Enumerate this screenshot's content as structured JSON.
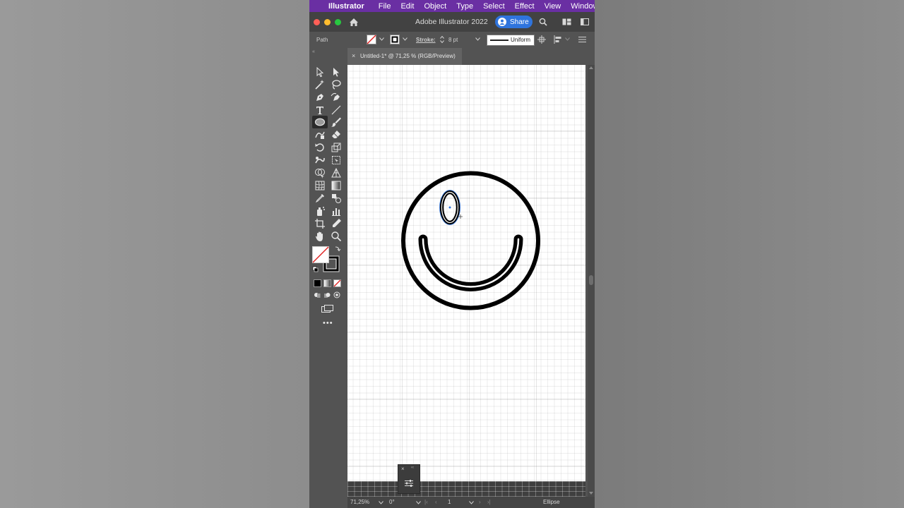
{
  "menubar": {
    "app_name": "Illustrator",
    "items": [
      "File",
      "Edit",
      "Object",
      "Type",
      "Select",
      "Effect",
      "View",
      "Window"
    ]
  },
  "titlebar": {
    "title": "Adobe Illustrator 2022",
    "share_label": "Share"
  },
  "controlbar": {
    "selection_label": "Path",
    "stroke_label": "Stroke:",
    "stroke_weight": "8 pt",
    "profile_label": "Uniform"
  },
  "document": {
    "tab_title": "Untitled-1* @ 71,25 % (RGB/Preview)"
  },
  "statusbar": {
    "zoom": "71,25%",
    "rotation": "0°",
    "artboard_number": "1",
    "current_tool": "Ellipse"
  },
  "colors": {
    "menubar": "#6a2fa3",
    "share_button": "#2f74dd",
    "ui_panel": "#535353"
  },
  "icons": {
    "tools": [
      "selection-tool-icon",
      "direct-selection-tool-icon",
      "magic-wand-tool-icon",
      "lasso-tool-icon",
      "pen-tool-icon",
      "curvature-tool-icon",
      "type-tool-icon",
      "line-segment-tool-icon",
      "ellipse-tool-icon",
      "paintbrush-tool-icon",
      "shaper-tool-icon",
      "eraser-tool-icon",
      "rotate-tool-icon",
      "scale-tool-icon",
      "warp-tool-icon",
      "free-transform-tool-icon",
      "shape-builder-tool-icon",
      "perspective-grid-tool-icon",
      "mesh-tool-icon",
      "gradient-tool-icon",
      "eyedropper-tool-icon",
      "blend-tool-icon",
      "symbol-sprayer-tool-icon",
      "column-graph-tool-icon",
      "artboard-tool-icon",
      "slice-tool-icon",
      "hand-tool-icon",
      "zoom-tool-icon"
    ]
  }
}
